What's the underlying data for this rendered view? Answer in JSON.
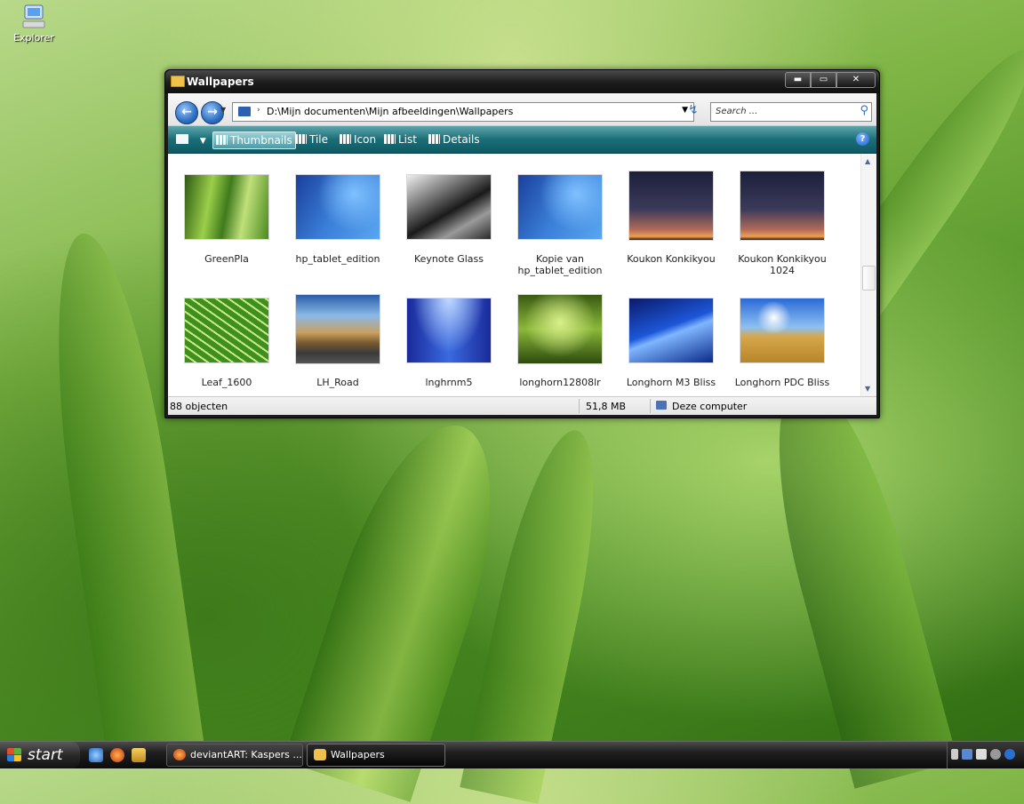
{
  "desktop": {
    "icon_label": "Explorer"
  },
  "window": {
    "title": "Wallpapers",
    "controls": {
      "minimize": "▬",
      "maximize": "▭",
      "close": "✕"
    }
  },
  "address_bar": {
    "back": "←",
    "forward": "→",
    "path_separator": "›",
    "path": "D:\\Mijn documenten\\Mijn afbeeldingen\\Wallpapers",
    "dropdown": "▼",
    "refresh": "↯",
    "search_placeholder": "Search ...",
    "search_icon": "⚲"
  },
  "toolbar": {
    "views_button": "▼",
    "items": [
      {
        "label": "Thumbnails",
        "active": true
      },
      {
        "label": "Tile",
        "active": false
      },
      {
        "label": "Icon",
        "active": false
      },
      {
        "label": "List",
        "active": false
      },
      {
        "label": "Details",
        "active": false
      }
    ],
    "help": "?"
  },
  "files": [
    {
      "name": "GreenPla",
      "thumb": "green-plant"
    },
    {
      "name": "hp_tablet_edition",
      "thumb": "blue-dots"
    },
    {
      "name": "Keynote Glass",
      "thumb": "glass"
    },
    {
      "name": "Kopie van hp_tablet_edition",
      "thumb": "blue-dots"
    },
    {
      "name": "Koukon Konkikyou",
      "thumb": "dusk"
    },
    {
      "name": "Koukon Konkikyou 1024",
      "thumb": "dusk"
    },
    {
      "name": "Leaf_1600",
      "thumb": "leaf"
    },
    {
      "name": "LH_Road",
      "thumb": "road"
    },
    {
      "name": "lnghrnm5",
      "thumb": "aurora"
    },
    {
      "name": "longhorn12808lr",
      "thumb": "grass"
    },
    {
      "name": "Longhorn M3 Bliss",
      "thumb": "blue-wave"
    },
    {
      "name": "Longhorn PDC Bliss",
      "thumb": "field"
    }
  ],
  "status": {
    "count": "88 objecten",
    "size": "51,8 MB",
    "location": "Deze computer"
  },
  "taskbar": {
    "start": "start",
    "tasks": [
      {
        "label": "deviantART: Kaspers ...",
        "active": false
      },
      {
        "label": "Wallpapers",
        "active": true
      }
    ]
  }
}
